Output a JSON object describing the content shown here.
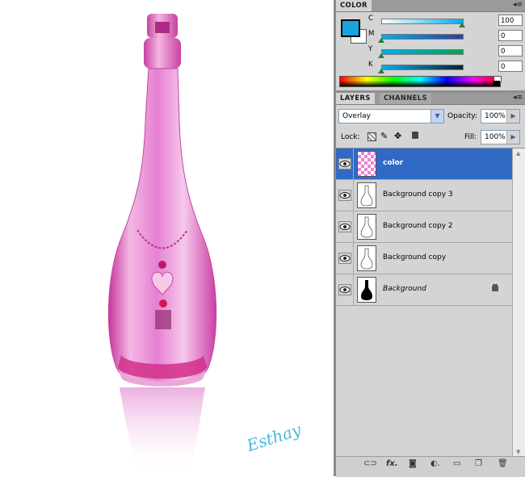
{
  "color_panel": {
    "tab_label": "COLOR",
    "foreground_color": "#1aa3e0",
    "background_color": "#ffffff",
    "channels": [
      {
        "label": "C",
        "value": "100",
        "level": 1.0,
        "gradient": "linear-gradient(to right,#ffffff,#00aeef)"
      },
      {
        "label": "M",
        "value": "0",
        "level": 0.0,
        "gradient": "linear-gradient(to right,#00aeef,#2f3f9c)"
      },
      {
        "label": "Y",
        "value": "0",
        "level": 0.0,
        "gradient": "linear-gradient(to right,#00aeef,#00a650)"
      },
      {
        "label": "K",
        "value": "0",
        "level": 0.0,
        "gradient": "linear-gradient(to right,#00aeef,#06222e)"
      }
    ],
    "percent_sign": "%"
  },
  "layers_panel": {
    "tabs": [
      "LAYERS",
      "CHANNELS"
    ],
    "blend_mode": "Overlay",
    "opacity_label": "Opacity:",
    "opacity_value": "100%",
    "lock_label": "Lock:",
    "fill_label": "Fill:",
    "fill_value": "100%",
    "layers": [
      {
        "name": "color",
        "selected": true,
        "italic": false,
        "locked": false
      },
      {
        "name": "Background copy 3",
        "selected": false,
        "italic": false,
        "locked": false
      },
      {
        "name": "Background copy 2",
        "selected": false,
        "italic": false,
        "locked": false
      },
      {
        "name": "Background copy",
        "selected": false,
        "italic": false,
        "locked": false
      },
      {
        "name": "Background",
        "selected": false,
        "italic": true,
        "locked": true
      }
    ]
  },
  "canvas": {
    "signature": "Esthay"
  },
  "colors": {
    "panel_bg": "#d4d4d4",
    "selection": "#316ac5",
    "bottle_pink": "#e27fd0"
  }
}
